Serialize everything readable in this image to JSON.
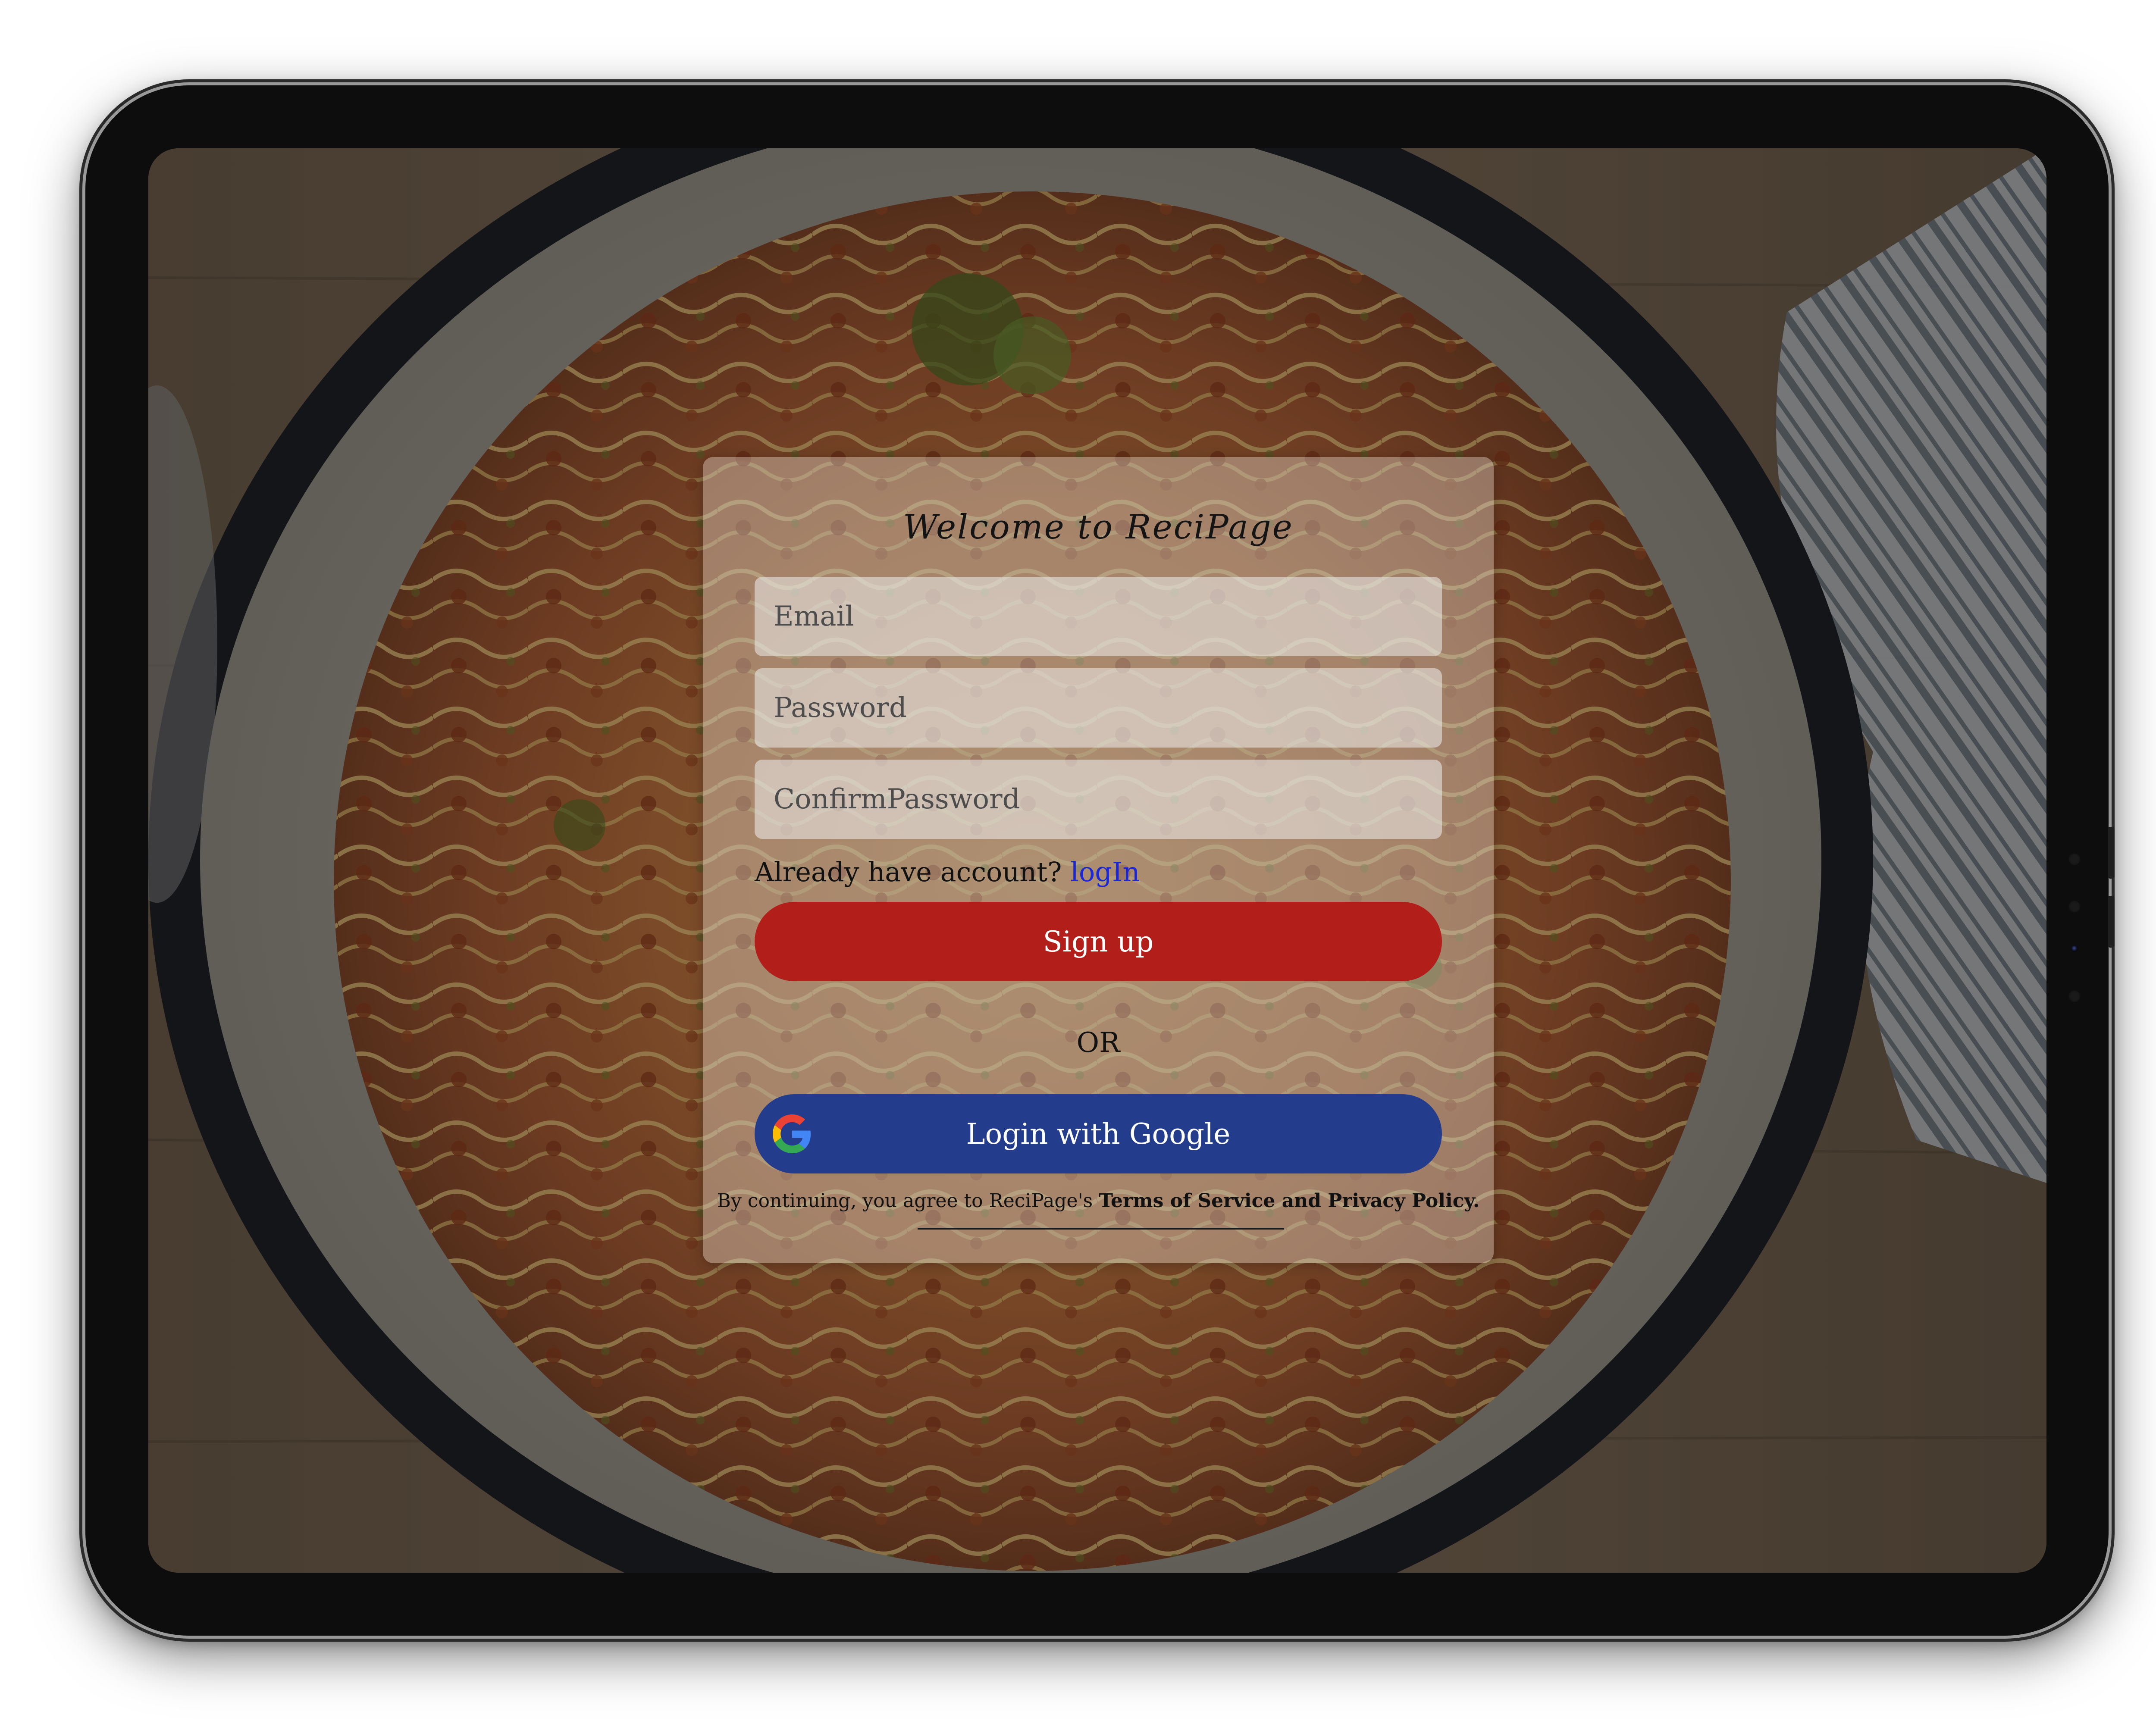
{
  "signup_card": {
    "title": "Welcome to ReciPage",
    "email_placeholder": "Email",
    "password_placeholder": "Password",
    "confirm_password_placeholder": "ConfirmPassword",
    "login_prompt": "Already have account? ",
    "login_link": "logIn",
    "signup_button": "Sign up",
    "or_divider": "OR",
    "google_button": "Login with Google",
    "terms_prefix": "By continuing, you agree to ReciPage's ",
    "terms_link": "Terms of Service and Privacy Policy."
  },
  "colors": {
    "signup_button": "#b21f1a",
    "google_button": "#233c8c",
    "login_link": "#1b27d4"
  },
  "icons": {
    "google": "google-g-logo"
  }
}
